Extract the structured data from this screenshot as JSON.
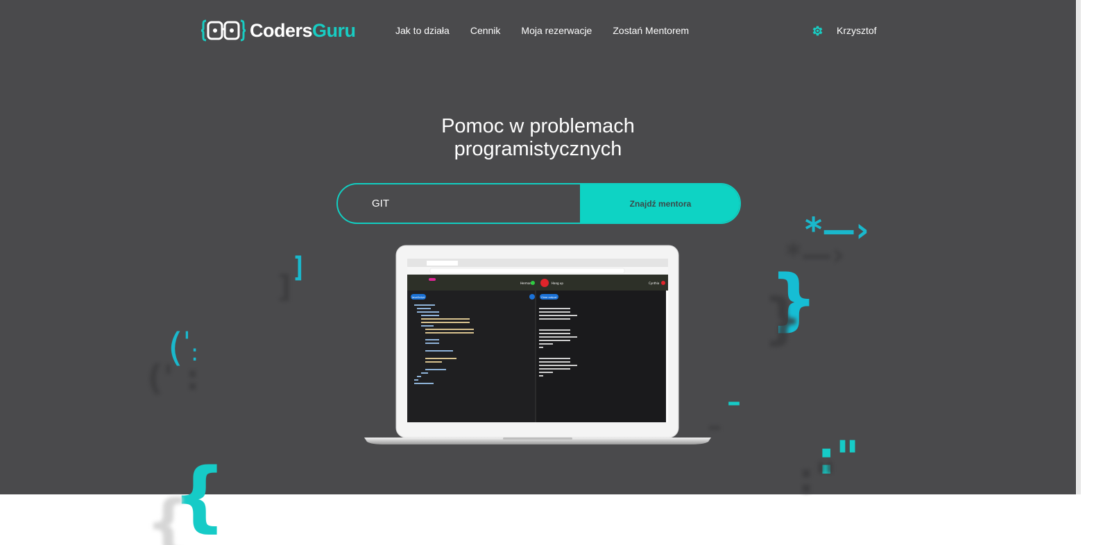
{
  "header": {
    "logo": {
      "text_main": "Coders",
      "text_accent": "Guru"
    },
    "nav": [
      {
        "label": "Jak to działa"
      },
      {
        "label": "Cennik"
      },
      {
        "label": "Moja rezerwacje"
      },
      {
        "label": "Zostań Mentorem"
      }
    ],
    "settings_icon": "gear-icon",
    "user": {
      "name": "Krzysztof"
    }
  },
  "hero": {
    "headline_line1": "Pomoc w problemach",
    "headline_line2": "programistycznych",
    "search": {
      "value": "GIT",
      "button_label": "Znajdź mentora"
    }
  },
  "colors": {
    "background": "#4a4a4c",
    "accent": "#0ed3c4",
    "glyph": "#1ab8cc",
    "text": "#ffffff"
  },
  "laptop_screen": {
    "language_badge": "JavaScript",
    "caller": "Herman",
    "hangup_label": "Hang up",
    "callee": "Cynthia",
    "clear_output_label": "Clear output"
  }
}
